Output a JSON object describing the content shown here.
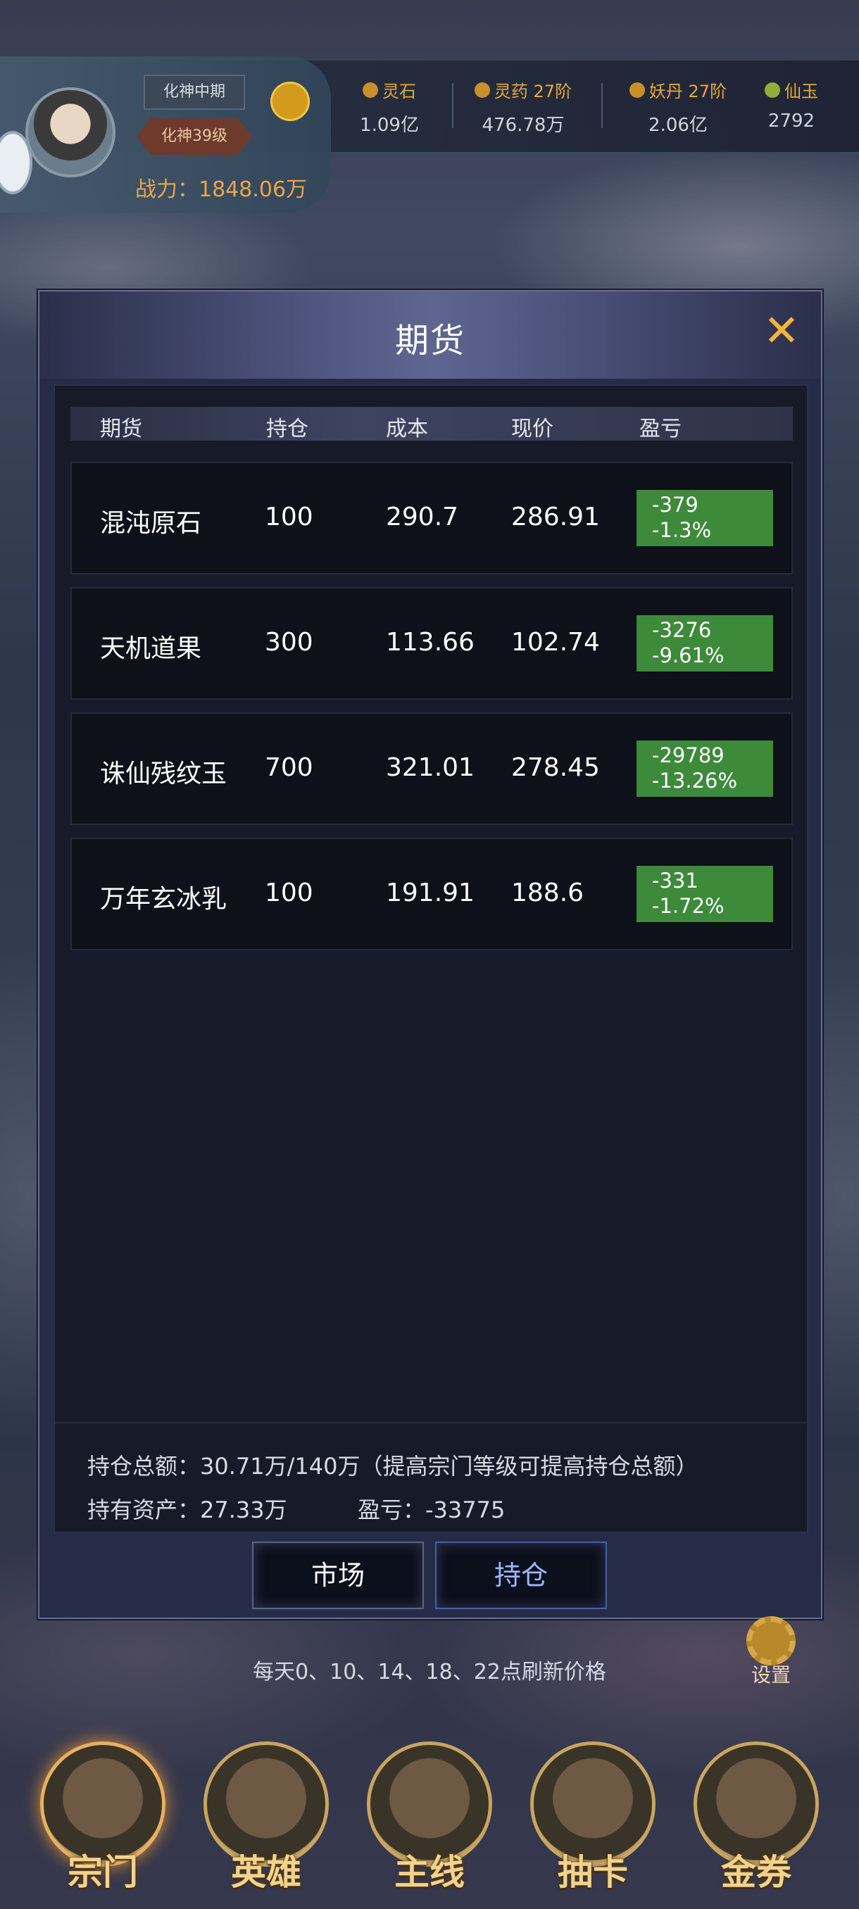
{
  "player": {
    "realm": "化神中期",
    "level": "化神39级",
    "power": "战力：1848.06万"
  },
  "resources": [
    {
      "name": "灵石",
      "value": "1.09亿"
    },
    {
      "name": "灵药 27阶",
      "value": "476.78万"
    },
    {
      "name": "妖丹 27阶",
      "value": "2.06亿"
    },
    {
      "name": "仙玉",
      "value": "2792"
    }
  ],
  "modal": {
    "title": "期货",
    "close_icon": "close-icon",
    "columns": [
      "期货",
      "持仓",
      "成本",
      "现价",
      "盈亏"
    ],
    "rows": [
      {
        "name": "混沌原石",
        "hold": "100",
        "cost": "290.7",
        "price": "286.91",
        "pl_amount": "-379",
        "pl_percent": "-1.3%"
      },
      {
        "name": "天机道果",
        "hold": "300",
        "cost": "113.66",
        "price": "102.74",
        "pl_amount": "-3276",
        "pl_percent": "-9.61%"
      },
      {
        "name": "诛仙残纹玉",
        "hold": "700",
        "cost": "321.01",
        "price": "278.45",
        "pl_amount": "-29789",
        "pl_percent": "-13.26%"
      },
      {
        "name": "万年玄冰乳",
        "hold": "100",
        "cost": "191.91",
        "price": "188.6",
        "pl_amount": "-331",
        "pl_percent": "-1.72%"
      }
    ],
    "summary_total": "持仓总额：30.71万/140万（提高宗门等级可提高持仓总额）",
    "summary_assets": "持有资产：27.33万",
    "summary_pl": "盈亏：-33775",
    "tabs": {
      "market": "市场",
      "holdings": "持仓"
    }
  },
  "refresh_note": "每天0、10、14、18、22点刷新价格",
  "settings_label": "设置",
  "nav": [
    "宗门",
    "英雄",
    "主线",
    "抽卡",
    "金券"
  ],
  "colors": {
    "profit_loss_bg": "#3d8a3a",
    "accent_gold": "#f3b43a",
    "active_tab_text": "#9db8ff"
  }
}
